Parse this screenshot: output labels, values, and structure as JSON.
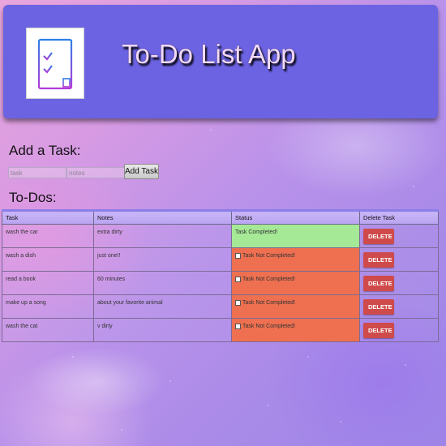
{
  "header": {
    "title": "To-Do List App",
    "logo_icon": "checklist-icon",
    "background_color": "#6c63e3"
  },
  "add_task": {
    "heading": "Add a Task:",
    "task_placeholder": "task",
    "task_value": "",
    "notes_placeholder": "notes",
    "notes_value": "",
    "button_label": "Add Task"
  },
  "todos": {
    "heading": "To-Dos:",
    "columns": [
      "Task",
      "Notes",
      "Status",
      "Delete Task"
    ],
    "rows": [
      {
        "task": "wash the car",
        "notes": "extra dirty",
        "status": "Task Completed!",
        "completed": true,
        "delete_label": "DELETE"
      },
      {
        "task": "wash a dish",
        "notes": "just one!!",
        "status": "Task Not Completed!",
        "completed": false,
        "delete_label": "DELETE"
      },
      {
        "task": "read a book",
        "notes": "60 minutes",
        "status": "Task Not Completed!",
        "completed": false,
        "delete_label": "DELETE"
      },
      {
        "task": "make up a song",
        "notes": "about your favorite animal",
        "status": "Task Not Completed!",
        "completed": false,
        "delete_label": "DELETE"
      },
      {
        "task": "wash the cat",
        "notes": "v dirty",
        "status": "Task Not Completed!",
        "completed": false,
        "delete_label": "DELETE"
      }
    ]
  },
  "colors": {
    "completed": "#a5e896",
    "not_completed": "#ee7050",
    "delete_button": "#cf4a4a"
  }
}
